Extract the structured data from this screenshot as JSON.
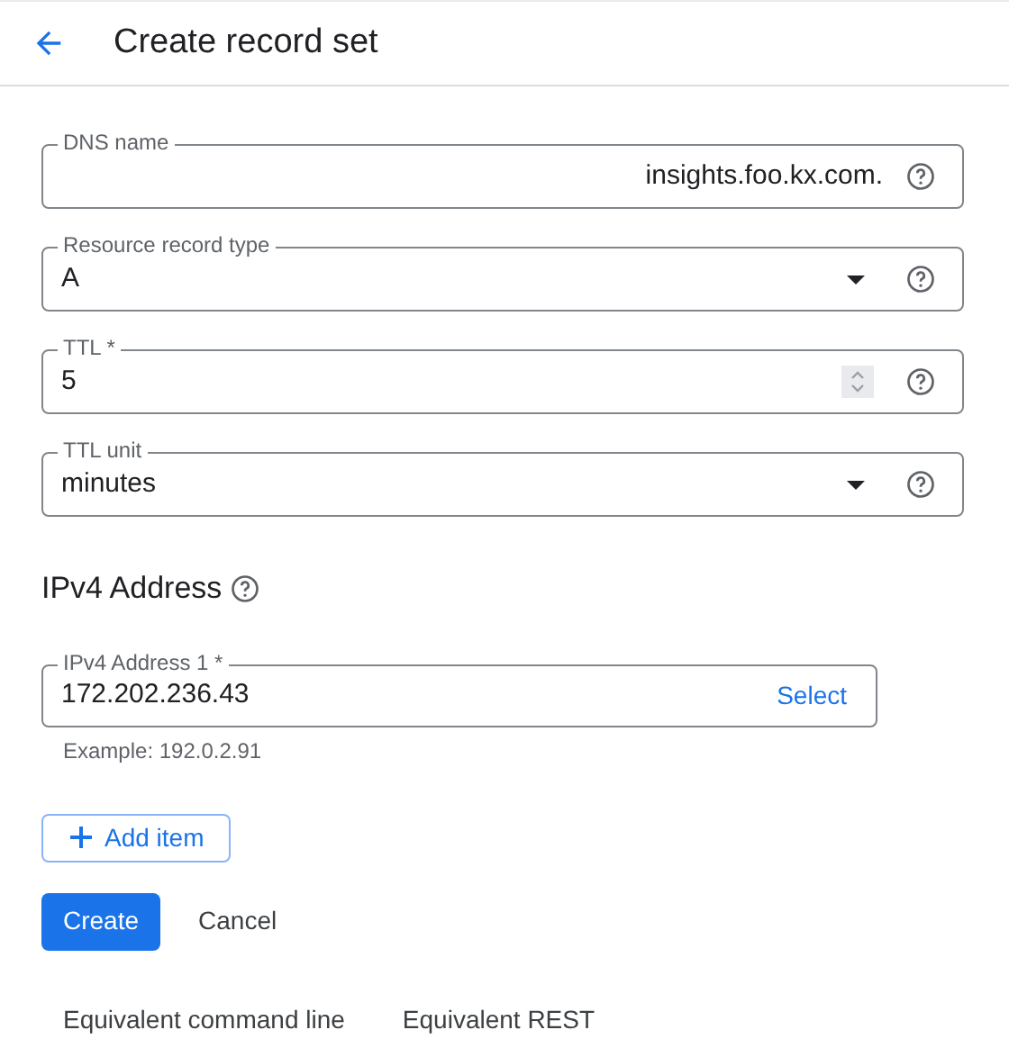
{
  "header": {
    "title": "Create record set"
  },
  "fields": [
    {
      "kind": "text",
      "label": "DNS name",
      "value": "insights.foo.kx.com."
    },
    {
      "kind": "select",
      "label": "Resource record type",
      "value": "A"
    },
    {
      "kind": "number",
      "label": "TTL *",
      "value": "5"
    },
    {
      "kind": "select",
      "label": "TTL unit",
      "value": "minutes"
    }
  ],
  "ipv4_section": {
    "heading": "IPv4 Address",
    "items": [
      {
        "label": "IPv4 Address 1 *",
        "value": "172.202.236.43",
        "action": "Select",
        "hint": "Example: 192.0.2.91"
      }
    ],
    "add_button": "Add item"
  },
  "buttons": {
    "primary": "Create",
    "secondary": "Cancel"
  },
  "links": [
    "Equivalent command line",
    "Equivalent REST"
  ]
}
